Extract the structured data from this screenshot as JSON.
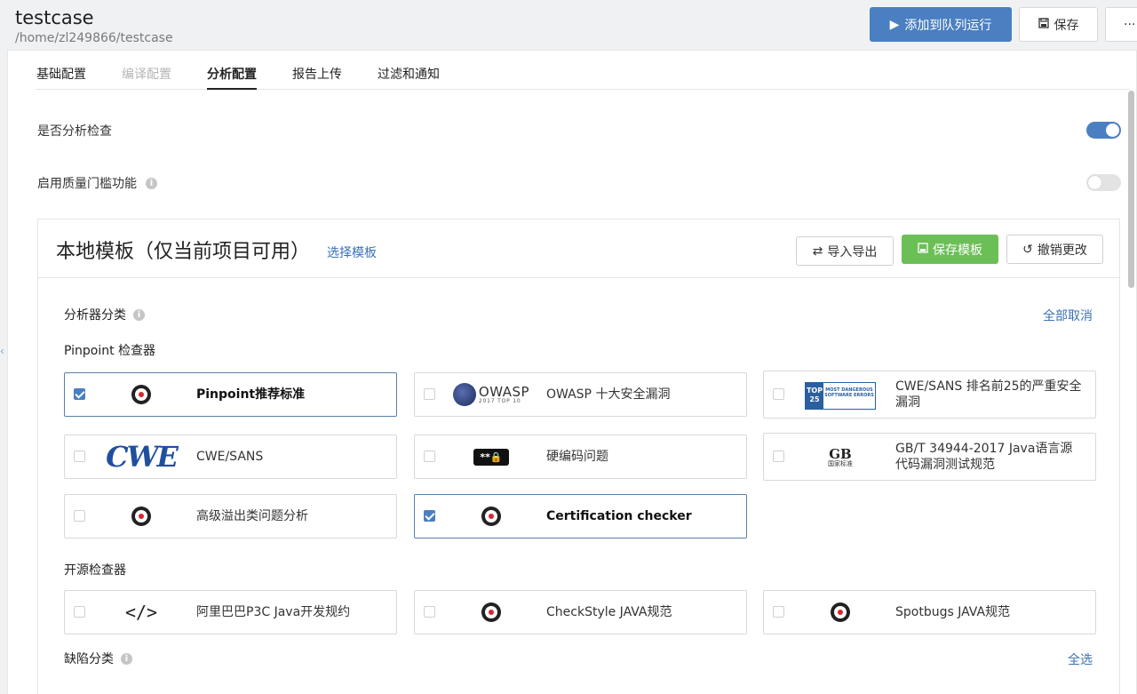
{
  "header": {
    "title": "testcase",
    "path": "/home/zl249866/testcase",
    "run_label": "添加到队列运行",
    "save_label": "保存",
    "more_label": "···"
  },
  "tabs": [
    "基础配置",
    "编译配置",
    "分析配置",
    "报告上传",
    "过滤和通知"
  ],
  "settings": {
    "analysis_label": "是否分析检查",
    "analysis_enabled": true,
    "quality_gate_label": "启用质量门槛功能",
    "quality_gate_enabled": false
  },
  "template": {
    "title": "本地模板（仅当前项目可用）",
    "select_link": "选择模板",
    "import_export": "导入导出",
    "save_template": "保存模板",
    "revert": "撤销更改"
  },
  "analyzer": {
    "title": "分析器分类",
    "deselect_all": "全部取消",
    "pinpoint_title": "Pinpoint 检查器",
    "pinpoint": [
      {
        "name": "Pinpoint推荐标准",
        "logo": "pinpoint-logo",
        "checked": true
      },
      {
        "name": "OWASP 十大安全漏洞",
        "logo": "owasp-logo",
        "checked": false,
        "logo_text": "OWASP",
        "logo_sub": "2017 TOP 10"
      },
      {
        "name": "CWE/SANS 排名前25的严重安全漏洞",
        "logo": "top25-logo",
        "checked": false,
        "logo_text": "TOP 25",
        "logo_sub": "MOST DANGEROUS SOFTWARE ERRORS"
      },
      {
        "name": "CWE/SANS",
        "logo": "cwe-logo",
        "checked": false,
        "logo_text": "CWE"
      },
      {
        "name": "硬编码问题",
        "logo": "password-logo",
        "checked": false,
        "logo_text": "**🔒"
      },
      {
        "name": "GB/T 34944-2017 Java语言源代码漏洞测试规范",
        "logo": "gb-logo",
        "checked": false,
        "logo_text": "GB",
        "logo_sub": "国家标准"
      },
      {
        "name": "高级溢出类问题分析",
        "logo": "pinpoint-logo",
        "checked": false
      },
      {
        "name": "Certification checker",
        "logo": "pinpoint-logo",
        "checked": true
      }
    ],
    "opensource_title": "开源检查器",
    "opensource": [
      {
        "name": "阿里巴巴P3C Java开发规约",
        "logo": "code-logo",
        "checked": false,
        "logo_text": "</>"
      },
      {
        "name": "CheckStyle JAVA规范",
        "logo": "pinpoint-logo",
        "checked": false
      },
      {
        "name": "Spotbugs JAVA规范",
        "logo": "pinpoint-logo",
        "checked": false
      }
    ]
  },
  "defects": {
    "title": "缺陷分类",
    "select_all": "全选"
  },
  "colors": {
    "primary": "#4a7fc1",
    "success": "#6cbf56",
    "link": "#3a72b8"
  }
}
